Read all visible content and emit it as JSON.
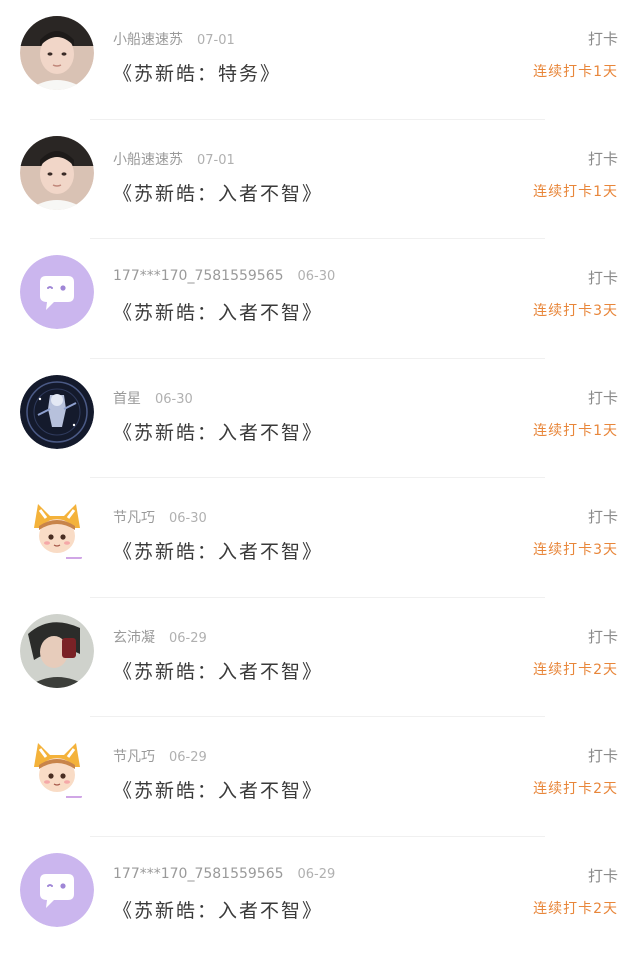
{
  "feed": {
    "items": [
      {
        "user": "小船速速苏",
        "date": "07-01",
        "title": "《苏新皓：特务》",
        "action": "打卡",
        "streak": "连续打卡1天",
        "avatar_icon": "photo-avatar-boy-icon"
      },
      {
        "user": "小船速速苏",
        "date": "07-01",
        "title": "《苏新皓：入者不智》",
        "action": "打卡",
        "streak": "连续打卡1天",
        "avatar_icon": "photo-avatar-boy-icon"
      },
      {
        "user": "177***170_7581559565",
        "date": "06-30",
        "title": "《苏新皓：入者不智》",
        "action": "打卡",
        "streak": "连续打卡3天",
        "avatar_icon": "default-chat-avatar-icon"
      },
      {
        "user": "首星",
        "date": "06-30",
        "title": "《苏新皓：入者不智》",
        "action": "打卡",
        "streak": "连续打卡1天",
        "avatar_icon": "dark-character-avatar-icon"
      },
      {
        "user": "节凡巧",
        "date": "06-30",
        "title": "《苏新皓：入者不智》",
        "action": "打卡",
        "streak": "连续打卡3天",
        "avatar_icon": "cartoon-cat-hat-avatar-icon"
      },
      {
        "user": "玄沛凝",
        "date": "06-29",
        "title": "《苏新皓：入者不智》",
        "action": "打卡",
        "streak": "连续打卡2天",
        "avatar_icon": "photo-avatar-drinking-icon"
      },
      {
        "user": "节凡巧",
        "date": "06-29",
        "title": "《苏新皓：入者不智》",
        "action": "打卡",
        "streak": "连续打卡2天",
        "avatar_icon": "cartoon-cat-hat-avatar-icon"
      },
      {
        "user": "177***170_7581559565",
        "date": "06-29",
        "title": "《苏新皓：入者不智》",
        "action": "打卡",
        "streak": "连续打卡2天",
        "avatar_icon": "default-chat-avatar-icon"
      }
    ]
  },
  "colors": {
    "streak": "#e8863a",
    "default_avatar_bg": "#cbb6ee"
  }
}
